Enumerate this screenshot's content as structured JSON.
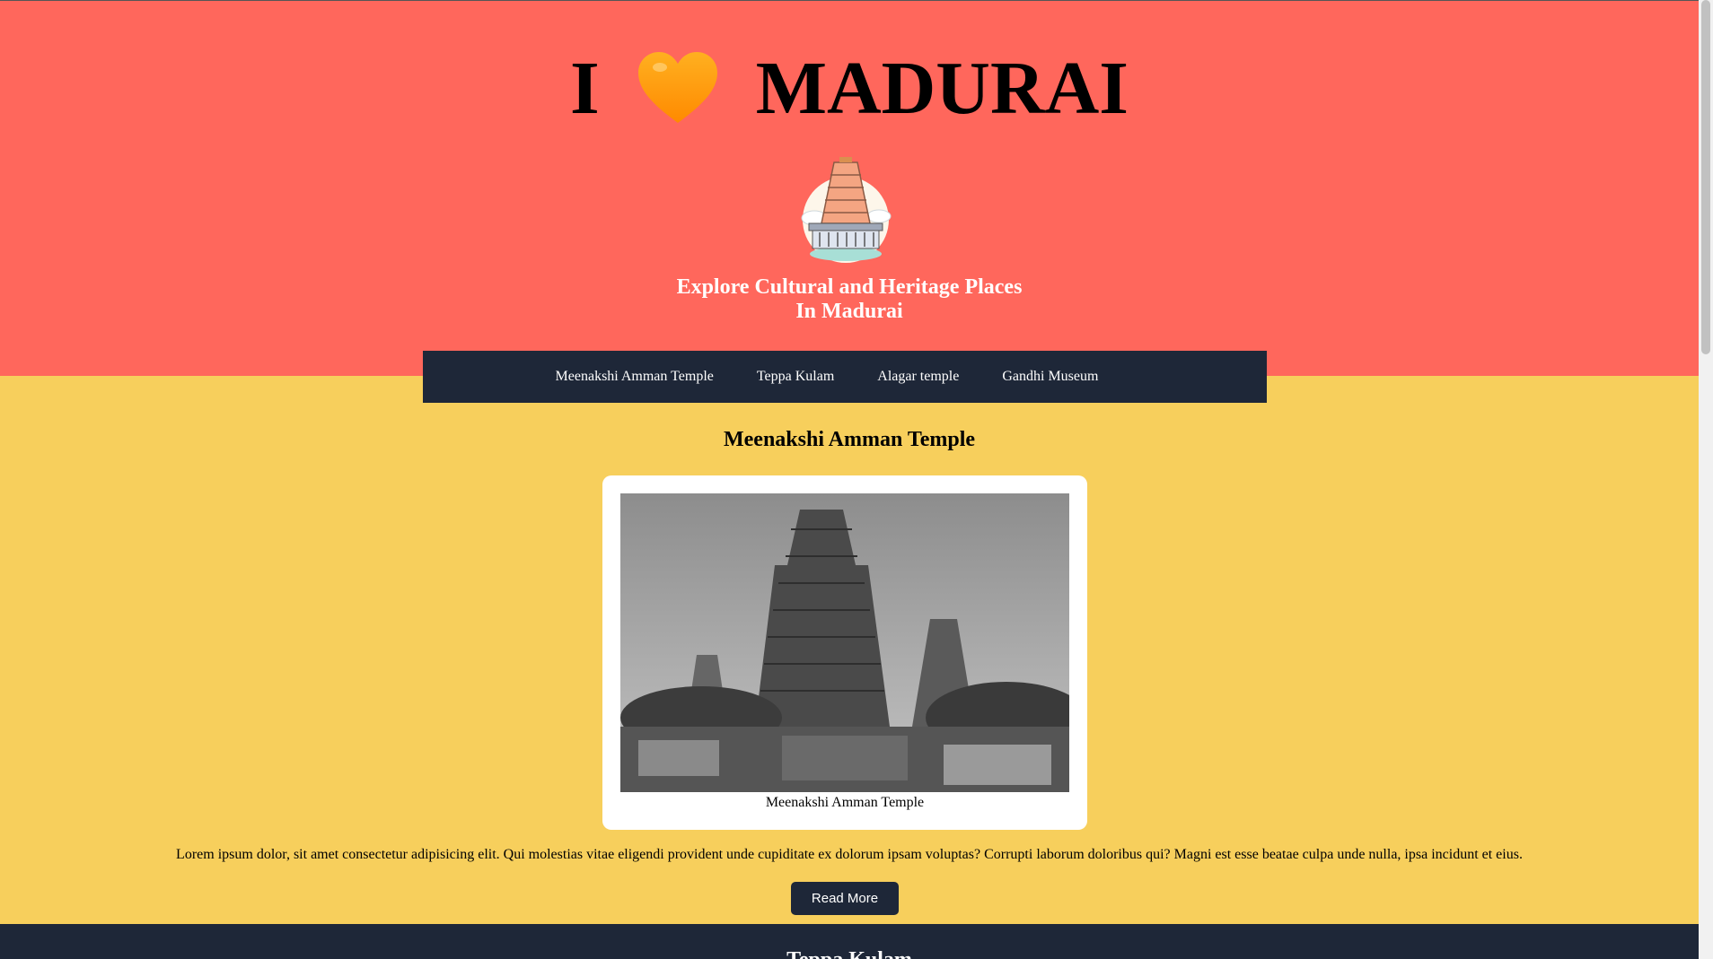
{
  "header": {
    "title_prefix": "I",
    "heart_icon": "orange-heart-icon",
    "title_suffix": "MADURAI",
    "tagline": "Explore Cultural and Heritage Places In Madurai",
    "accent_color": "#ff675c"
  },
  "nav": {
    "items": [
      {
        "label": "Meenakshi Amman Temple"
      },
      {
        "label": "Teppa Kulam"
      },
      {
        "label": "Alagar temple"
      },
      {
        "label": "Gandhi Museum"
      }
    ]
  },
  "section": {
    "title": "Meenakshi Amman Temple",
    "caption": "Meenakshi Amman Temple",
    "description": "Lorem ipsum dolor, sit amet consectetur adipisicing elit. Qui molestias vitae eligendi provident unde cupiditate ex dolorum ipsam voluptas? Corrupti laborum doloribus qui? Magni est esse beatae culpa unde nulla, ipsa incidunt et eius.",
    "button_label": "Read More",
    "background_color": "#f7cf5c"
  },
  "next_section": {
    "title": "Teppa Kulam",
    "background_color": "#1e2738"
  }
}
